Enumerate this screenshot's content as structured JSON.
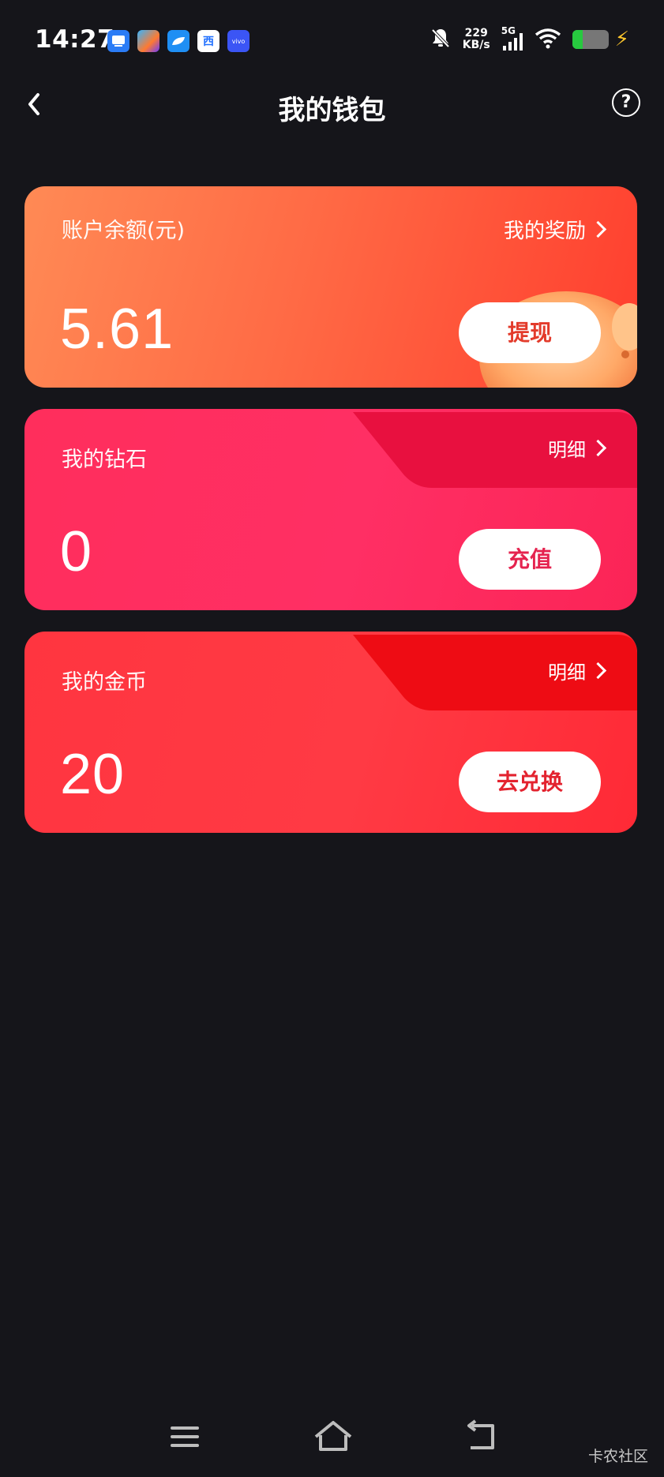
{
  "status_bar": {
    "time": "14:27",
    "net_speed_value": "229",
    "net_speed_unit": "KB/s",
    "net_type": "5G",
    "app_icons": [
      "screen-icon",
      "gallery-icon",
      "leaf-icon",
      "xi-icon",
      "vivo-icon"
    ],
    "app_icon_texts": [
      "",
      "",
      "",
      "西",
      "vivo"
    ]
  },
  "header": {
    "title": "我的钱包",
    "back_icon": "chevron-left-icon",
    "help_icon": "help-icon",
    "help_symbol": "?"
  },
  "balance_card": {
    "label": "账户余额(元)",
    "value": "5.61",
    "link": "我的奖励",
    "button": "提现"
  },
  "diamond_card": {
    "label": "我的钻石",
    "value": "0",
    "link": "明细",
    "button": "充值"
  },
  "coin_card": {
    "label": "我的金币",
    "value": "20",
    "link": "明细",
    "button": "去兑换"
  },
  "watermark": "卡农社区",
  "colors": {
    "background": "#15151a",
    "balance_card": "#ff6a45",
    "diamond_card": "#ff2f64",
    "coin_card": "#ff3a44"
  }
}
